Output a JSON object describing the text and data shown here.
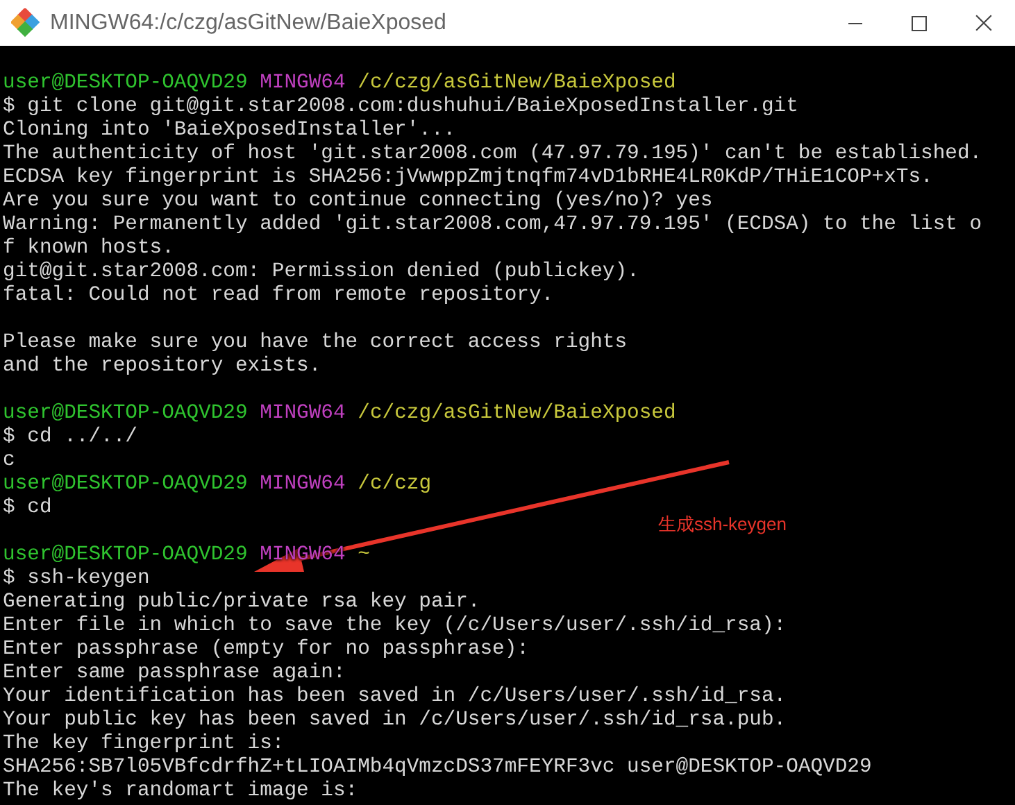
{
  "window": {
    "title": "MINGW64:/c/czg/asGitNew/BaieXposed"
  },
  "terminal": {
    "lines": [
      {
        "kind": "prompt",
        "user": "user@DESKTOP-OAQVD29",
        "shell": "MINGW64",
        "path": "/c/czg/asGitNew/BaieXposed"
      },
      {
        "kind": "text",
        "text": "$ git clone git@git.star2008.com:dushuhui/BaieXposedInstaller.git"
      },
      {
        "kind": "text",
        "text": "Cloning into 'BaieXposedInstaller'..."
      },
      {
        "kind": "text",
        "text": "The authenticity of host 'git.star2008.com (47.97.79.195)' can't be established."
      },
      {
        "kind": "text",
        "text": "ECDSA key fingerprint is SHA256:jVwwppZmjtnqfm74vD1bRHE4LR0KdP/THiE1COP+xTs."
      },
      {
        "kind": "text",
        "text": "Are you sure you want to continue connecting (yes/no)? yes"
      },
      {
        "kind": "text",
        "text": "Warning: Permanently added 'git.star2008.com,47.97.79.195' (ECDSA) to the list o"
      },
      {
        "kind": "text",
        "text": "f known hosts."
      },
      {
        "kind": "text",
        "text": "git@git.star2008.com: Permission denied (publickey)."
      },
      {
        "kind": "text",
        "text": "fatal: Could not read from remote repository."
      },
      {
        "kind": "blank"
      },
      {
        "kind": "text",
        "text": "Please make sure you have the correct access rights"
      },
      {
        "kind": "text",
        "text": "and the repository exists."
      },
      {
        "kind": "blank"
      },
      {
        "kind": "prompt",
        "user": "user@DESKTOP-OAQVD29",
        "shell": "MINGW64",
        "path": "/c/czg/asGitNew/BaieXposed"
      },
      {
        "kind": "text",
        "text": "$ cd ../../"
      },
      {
        "kind": "text",
        "text": "c"
      },
      {
        "kind": "prompt",
        "user": "user@DESKTOP-OAQVD29",
        "shell": "MINGW64",
        "path": "/c/czg"
      },
      {
        "kind": "text",
        "text": "$ cd"
      },
      {
        "kind": "blank"
      },
      {
        "kind": "prompt",
        "user": "user@DESKTOP-OAQVD29",
        "shell": "MINGW64",
        "path": "~"
      },
      {
        "kind": "text",
        "text": "$ ssh-keygen"
      },
      {
        "kind": "text",
        "text": "Generating public/private rsa key pair."
      },
      {
        "kind": "text",
        "text": "Enter file in which to save the key (/c/Users/user/.ssh/id_rsa):"
      },
      {
        "kind": "text",
        "text": "Enter passphrase (empty for no passphrase):"
      },
      {
        "kind": "text",
        "text": "Enter same passphrase again:"
      },
      {
        "kind": "text",
        "text": "Your identification has been saved in /c/Users/user/.ssh/id_rsa."
      },
      {
        "kind": "text",
        "text": "Your public key has been saved in /c/Users/user/.ssh/id_rsa.pub."
      },
      {
        "kind": "text",
        "text": "The key fingerprint is:"
      },
      {
        "kind": "text",
        "text": "SHA256:SB7l05VBfcdrfhZ+tLIOAIMb4qVmzcDS37mFEYRF3vc user@DESKTOP-OAQVD29"
      },
      {
        "kind": "text",
        "text": "The key's randomart image is:"
      }
    ]
  },
  "annotation": {
    "text": "生成ssh-keygen"
  }
}
